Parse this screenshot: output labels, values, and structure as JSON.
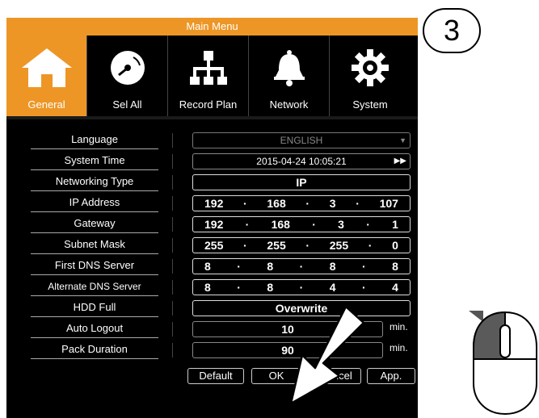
{
  "window": {
    "title": "Main Menu"
  },
  "tabs": [
    {
      "label": "General",
      "icon": "home-icon"
    },
    {
      "label": "Sel All",
      "icon": "disk-icon"
    },
    {
      "label": "Record Plan",
      "icon": "network-tree-icon"
    },
    {
      "label": "Network",
      "icon": "bell-icon"
    },
    {
      "label": "System",
      "icon": "gear-icon"
    }
  ],
  "settings": {
    "language": {
      "label": "Language",
      "value": "ENGLISH"
    },
    "system_time": {
      "label": "System Time",
      "value": "2015-04-24 10:05:21"
    },
    "networking_type": {
      "label": "Networking Type",
      "value": "IP"
    },
    "ip_address": {
      "label": "IP Address",
      "octets": [
        "192",
        "168",
        "3",
        "107"
      ]
    },
    "gateway": {
      "label": "Gateway",
      "octets": [
        "192",
        "168",
        "3",
        "1"
      ]
    },
    "subnet_mask": {
      "label": "Subnet Mask",
      "octets": [
        "255",
        "255",
        "255",
        "0"
      ]
    },
    "first_dns": {
      "label": "First DNS Server",
      "octets": [
        "8",
        "8",
        "8",
        "8"
      ]
    },
    "alternate_dns": {
      "label": "Alternate DNS Server",
      "octets": [
        "8",
        "8",
        "4",
        "4"
      ]
    },
    "hdd_full": {
      "label": "HDD Full",
      "value": "Overwrite"
    },
    "auto_logout": {
      "label": "Auto Logout",
      "value": "10",
      "unit": "min."
    },
    "pack_duration": {
      "label": "Pack Duration",
      "value": "90",
      "unit": "min."
    }
  },
  "separator": "·",
  "buttons": {
    "default": "Default",
    "ok": "OK",
    "cancel": "Cancel",
    "apply": "App."
  },
  "step_badge": "3",
  "colors": {
    "accent": "#ed9626",
    "background": "#000000",
    "text": "#ffffff"
  }
}
